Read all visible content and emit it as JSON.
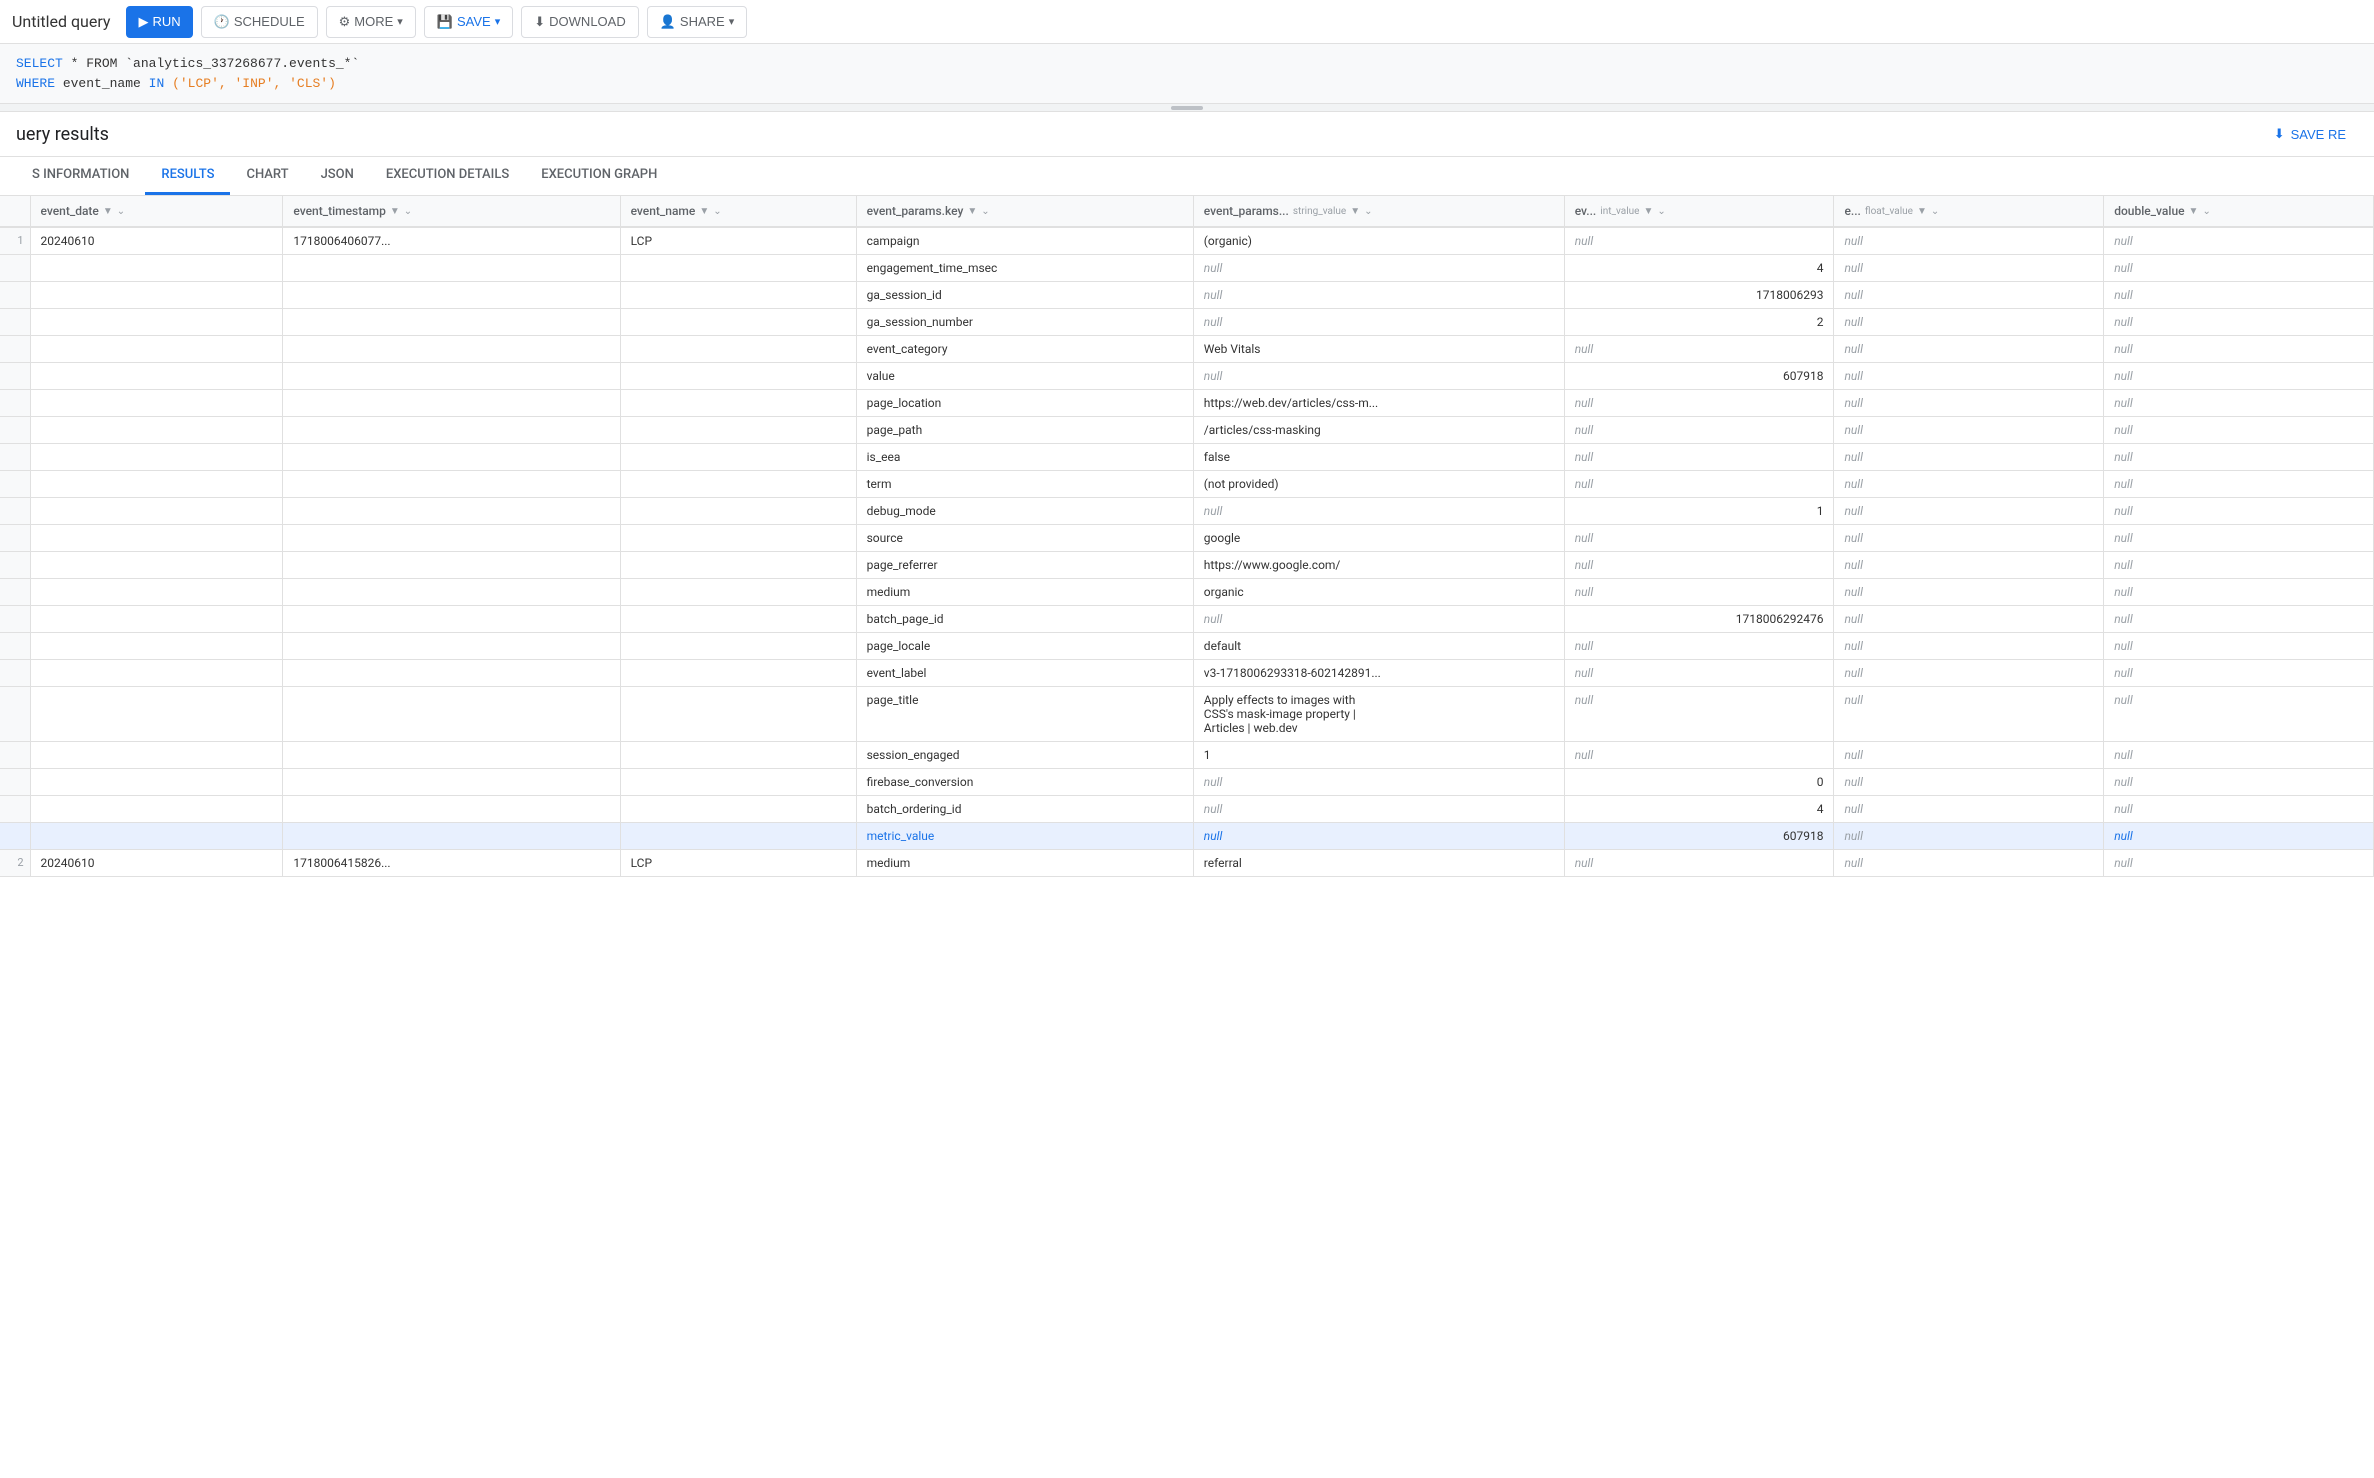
{
  "topbar": {
    "title": "Untitled query",
    "run_label": "RUN",
    "schedule_label": "SCHEDULE",
    "more_label": "MORE",
    "save_label": "SAVE",
    "download_label": "DOWNLOAD",
    "share_label": "SHARE"
  },
  "sql": {
    "line1_keyword1": "SELECT",
    "line1_rest": " * FROM `analytics_337268677.events_*`",
    "line2_keyword": "WHERE",
    "line2_col": " event_name",
    "line2_op": " IN",
    "line2_values": " ('LCP', 'INP', 'CLS')"
  },
  "results": {
    "title": "uery results",
    "save_results_label": "SAVE RE",
    "tabs": [
      {
        "id": "schema-info",
        "label": "S INFORMATION"
      },
      {
        "id": "results",
        "label": "RESULTS"
      },
      {
        "id": "chart",
        "label": "CHART"
      },
      {
        "id": "json",
        "label": "JSON"
      },
      {
        "id": "execution-details",
        "label": "EXECUTION DETAILS"
      },
      {
        "id": "execution-graph",
        "label": "EXECUTION GRAPH"
      }
    ],
    "active_tab": "results",
    "columns": [
      {
        "name": "event_date",
        "type": "",
        "sort": true,
        "filter": false
      },
      {
        "name": "event_timestamp",
        "type": "",
        "sort": true,
        "filter": false
      },
      {
        "name": "event_name",
        "type": "",
        "sort": true,
        "filter": false
      },
      {
        "name": "event_params.key",
        "type": "",
        "sort": true,
        "filter": true
      },
      {
        "name": "event_params... string_value",
        "type": "",
        "sort": true,
        "filter": true
      },
      {
        "name": "ev... int_value",
        "type": "",
        "sort": true,
        "filter": true
      },
      {
        "name": "e... float_value",
        "type": "",
        "sort": true,
        "filter": true
      },
      {
        "name": "double_value",
        "type": "",
        "sort": true,
        "filter": true
      }
    ],
    "rows": [
      {
        "row_num": "1",
        "event_date": "20240610",
        "event_timestamp": "1718006406077...",
        "event_name": "LCP",
        "params": [
          {
            "key": "campaign",
            "string_value": "(organic)",
            "int_value": "",
            "float_value": "",
            "double_value": ""
          },
          {
            "key": "engagement_time_msec",
            "string_value": "null",
            "int_value": "4",
            "float_value": "",
            "double_value": ""
          },
          {
            "key": "ga_session_id",
            "string_value": "null",
            "int_value": "1718006293",
            "float_value": "",
            "double_value": ""
          },
          {
            "key": "ga_session_number",
            "string_value": "null",
            "int_value": "2",
            "float_value": "",
            "double_value": ""
          },
          {
            "key": "event_category",
            "string_value": "Web Vitals",
            "int_value": "",
            "float_value": "",
            "double_value": ""
          },
          {
            "key": "value",
            "string_value": "null",
            "int_value": "607918",
            "float_value": "",
            "double_value": ""
          },
          {
            "key": "page_location",
            "string_value": "https://web.dev/articles/css-m...",
            "int_value": "",
            "float_value": "",
            "double_value": ""
          },
          {
            "key": "page_path",
            "string_value": "/articles/css-masking",
            "int_value": "",
            "float_value": "",
            "double_value": ""
          },
          {
            "key": "is_eea",
            "string_value": "false",
            "int_value": "",
            "float_value": "",
            "double_value": ""
          },
          {
            "key": "term",
            "string_value": "(not provided)",
            "int_value": "",
            "float_value": "",
            "double_value": ""
          },
          {
            "key": "debug_mode",
            "string_value": "null",
            "int_value": "1",
            "float_value": "",
            "double_value": ""
          },
          {
            "key": "source",
            "string_value": "google",
            "int_value": "",
            "float_value": "",
            "double_value": ""
          },
          {
            "key": "page_referrer",
            "string_value": "https://www.google.com/",
            "int_value": "",
            "float_value": "",
            "double_value": ""
          },
          {
            "key": "medium",
            "string_value": "organic",
            "int_value": "",
            "float_value": "",
            "double_value": ""
          },
          {
            "key": "batch_page_id",
            "string_value": "null",
            "int_value": "1718006292476",
            "float_value": "",
            "double_value": ""
          },
          {
            "key": "page_locale",
            "string_value": "default",
            "int_value": "",
            "float_value": "",
            "double_value": ""
          },
          {
            "key": "event_label",
            "string_value": "v3-1718006293318-602142891...",
            "int_value": "",
            "float_value": "",
            "double_value": ""
          },
          {
            "key": "page_title",
            "string_value": "Apply effects to images with\nCSS's mask-image property  |\nArticles  |  web.dev",
            "int_value": "",
            "float_value": "",
            "double_value": ""
          },
          {
            "key": "session_engaged",
            "string_value": "1",
            "int_value": "",
            "float_value": "",
            "double_value": ""
          },
          {
            "key": "firebase_conversion",
            "string_value": "null",
            "int_value": "0",
            "float_value": "",
            "double_value": ""
          },
          {
            "key": "batch_ordering_id",
            "string_value": "null",
            "int_value": "4",
            "float_value": "",
            "double_value": ""
          },
          {
            "key": "metric_value",
            "string_value": "null",
            "int_value": "607918",
            "float_value": "",
            "double_value": "",
            "highlighted": true
          }
        ]
      },
      {
        "row_num": "2",
        "event_date": "20240610",
        "event_timestamp": "1718006415826...",
        "event_name": "LCP",
        "params": [
          {
            "key": "medium",
            "string_value": "referral",
            "int_value": "",
            "float_value": "",
            "double_value": ""
          }
        ]
      }
    ]
  }
}
